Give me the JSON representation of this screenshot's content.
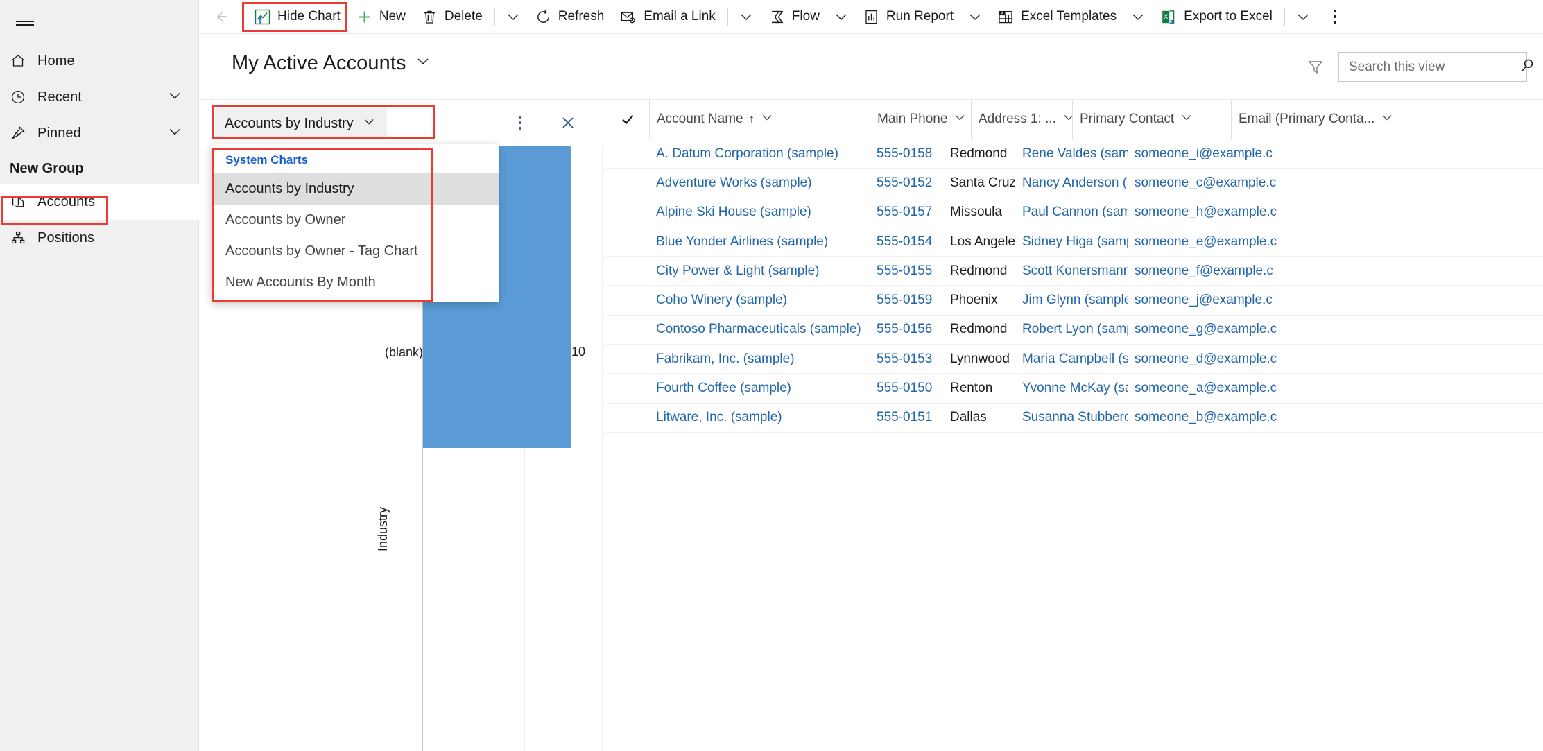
{
  "sidebar": {
    "menu_icon": "hamburger-icon",
    "items": [
      {
        "label": "Home",
        "icon": "home-icon",
        "chevron": false
      },
      {
        "label": "Recent",
        "icon": "clock-icon",
        "chevron": true
      },
      {
        "label": "Pinned",
        "icon": "pin-icon",
        "chevron": true
      }
    ],
    "group_label": "New Group",
    "entities": [
      {
        "label": "Accounts",
        "icon": "accounts-icon",
        "selected": true
      },
      {
        "label": "Positions",
        "icon": "positions-icon",
        "selected": false
      }
    ]
  },
  "commandbar": {
    "back_icon": "back-arrow-icon",
    "buttons": [
      {
        "label": "Hide Chart",
        "icon": "chart-icon",
        "caret": false,
        "highlighted": true
      },
      {
        "label": "New",
        "icon": "plus-icon",
        "caret": false
      },
      {
        "label": "Delete",
        "icon": "trash-icon",
        "caret": true
      },
      {
        "label": "Refresh",
        "icon": "refresh-icon",
        "caret": false
      },
      {
        "label": "Email a Link",
        "icon": "email-link-icon",
        "caret": true
      },
      {
        "label": "Flow",
        "icon": "flow-icon",
        "caret": true
      },
      {
        "label": "Run Report",
        "icon": "report-icon",
        "caret": true
      },
      {
        "label": "Excel Templates",
        "icon": "excel-template-icon",
        "caret": true
      },
      {
        "label": "Export to Excel",
        "icon": "excel-export-icon",
        "caret": true
      }
    ],
    "overflow_icon": "more-vertical-icon"
  },
  "viewheader": {
    "title": "My Active Accounts",
    "title_chevron_icon": "chevron-down-icon",
    "filter_icon": "filter-icon",
    "search": {
      "placeholder": "Search this view",
      "value": "",
      "icon": "search-icon"
    }
  },
  "chartpanel": {
    "selector_label": "Accounts by Industry",
    "selector_chevron_icon": "chevron-down-icon",
    "kebab_icon": "more-vertical-icon",
    "close_icon": "close-icon",
    "menu": {
      "section_label": "System Charts",
      "items": [
        {
          "label": "Accounts by Industry",
          "active": true
        },
        {
          "label": "Accounts by Owner",
          "active": false
        },
        {
          "label": "Accounts by Owner - Tag Chart",
          "active": false
        },
        {
          "label": "New Accounts By Month",
          "active": false
        }
      ]
    }
  },
  "chart_data": {
    "type": "bar",
    "orientation": "horizontal",
    "title": "",
    "categories": [
      "(blank)"
    ],
    "values": [
      10
    ],
    "value_labels": [
      "10"
    ],
    "xlabel": "",
    "ylabel": "Industry",
    "grid": true,
    "gridline_count": 5,
    "bar_color": "#5b9bd5",
    "legend": "none"
  },
  "grid": {
    "select_all_icon": "checkmark-icon",
    "columns": [
      {
        "label": "Account Name",
        "sorted": "asc",
        "sort_icon": "arrow-up-icon",
        "menu_icon": "chevron-down-icon"
      },
      {
        "label": "Main Phone",
        "sorted": "none",
        "menu_icon": "chevron-down-icon"
      },
      {
        "label": "Address 1: ...",
        "sorted": "none",
        "menu_icon": "chevron-down-icon"
      },
      {
        "label": "Primary Contact",
        "sorted": "none",
        "menu_icon": "chevron-down-icon"
      },
      {
        "label": "Email (Primary Conta...",
        "sorted": "none",
        "menu_icon": "chevron-down-icon"
      }
    ],
    "rows": [
      {
        "name": "A. Datum Corporation (sample)",
        "phone": "555-0158",
        "address": "Redmond",
        "contact": "Rene Valdes (sample)",
        "email": "someone_i@example.c"
      },
      {
        "name": "Adventure Works (sample)",
        "phone": "555-0152",
        "address": "Santa Cruz",
        "contact": "Nancy Anderson (samp",
        "email": "someone_c@example.c"
      },
      {
        "name": "Alpine Ski House (sample)",
        "phone": "555-0157",
        "address": "Missoula",
        "contact": "Paul Cannon (sample)..",
        "email": "someone_h@example.c"
      },
      {
        "name": "Blue Yonder Airlines (sample)",
        "phone": "555-0154",
        "address": "Los Angeles",
        "contact": "Sidney Higa (sample)",
        "email": "someone_e@example.c"
      },
      {
        "name": "City Power & Light (sample)",
        "phone": "555-0155",
        "address": "Redmond",
        "contact": "Scott Konersmann (sam",
        "email": "someone_f@example.c"
      },
      {
        "name": "Coho Winery (sample)",
        "phone": "555-0159",
        "address": "Phoenix",
        "contact": "Jim Glynn (sample)",
        "email": "someone_j@example.c"
      },
      {
        "name": "Contoso Pharmaceuticals (sample)",
        "phone": "555-0156",
        "address": "Redmond",
        "contact": "Robert Lyon (sample)",
        "email": "someone_g@example.c"
      },
      {
        "name": "Fabrikam, Inc. (sample)",
        "phone": "555-0153",
        "address": "Lynnwood",
        "contact": "Maria Campbell (sampl",
        "email": "someone_d@example.c"
      },
      {
        "name": "Fourth Coffee (sample)",
        "phone": "555-0150",
        "address": "Renton",
        "contact": "Yvonne McKay (sample",
        "email": "someone_a@example.c"
      },
      {
        "name": "Litware, Inc. (sample)",
        "phone": "555-0151",
        "address": "Dallas",
        "contact": "Susanna Stubberod (sa",
        "email": "someone_b@example.c"
      }
    ]
  },
  "colors": {
    "highlight": "#ee3a36",
    "bar": "#5b9bd5",
    "link": "#2266aa",
    "menu_section": "#1a5fd0"
  }
}
